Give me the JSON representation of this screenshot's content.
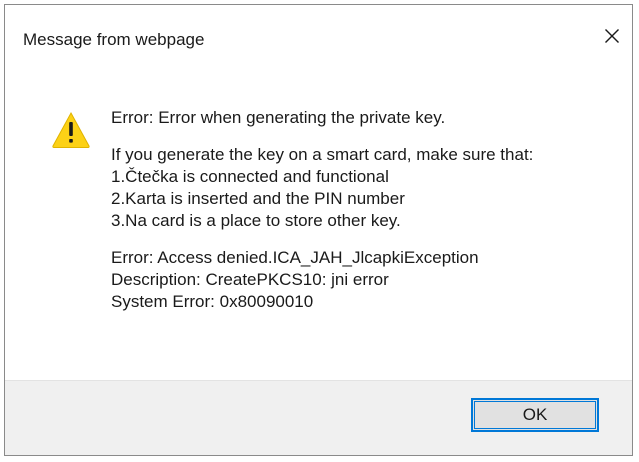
{
  "window": {
    "title": "Message from webpage",
    "close_icon": "close-icon"
  },
  "message": {
    "icon": "warning-icon",
    "error_line": "Error: Error when generating the private key.",
    "intro": "If you generate the key on a smart card, make sure that:",
    "items": [
      "1.Čtečka is connected and functional",
      "2.Karta is inserted and the PIN number",
      "3.Na card is a place to store other key."
    ],
    "details": [
      "Error: Access denied.ICA_JAH_JlcapkiException",
      "Description: CreatePKCS10: jni error",
      "System Error: 0x80090010"
    ]
  },
  "footer": {
    "ok_label": "OK"
  },
  "colors": {
    "accent": "#0078d7",
    "warning_fill": "#fcd116",
    "footer_bg": "#f0f0f0"
  }
}
